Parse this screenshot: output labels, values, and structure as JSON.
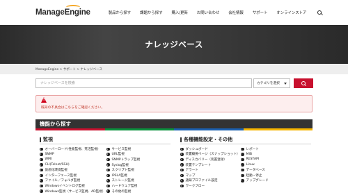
{
  "header": {
    "logo": "ManageEngine",
    "nav": [
      "製品から探す",
      "課題から探す",
      "購入/更新",
      "お問い合わせ",
      "会社情報",
      "サポート",
      "オンラインストア"
    ],
    "search_icon": "search-icon"
  },
  "hero": {
    "title": "ナレッジベース"
  },
  "breadcrumb": "ManageEngine > サポート > ナレッジベース",
  "search": {
    "placeholder": "ナレッジベースを検索",
    "category_label": "カテゴリを選択",
    "button_icon": "search-icon"
  },
  "alert": {
    "icon": "warning-icon",
    "text": "既知の不具合はこちらをご確認ください。"
  },
  "features": {
    "title": "機能から探す",
    "stripe_colors": [
      "#c8102e",
      "#0a8f3c",
      "#1b5fae",
      "#f5b400"
    ],
    "monitoring": {
      "title": "監視",
      "col1": [
        "オーバーロード(性能監視、死活監視)",
        "SNMP",
        "WMI",
        "CLI(Telnet/SSH)",
        "仮想化環境監視",
        "インターフェース監視",
        "ファイル／フォルダ監視",
        "Windowsイベントログ監視",
        "Windows監視（サービス監視、AD監視）"
      ],
      "col2": [
        "サービス監視",
        "URL監視",
        "SNMPトラップ監視",
        "Syslog監視",
        "スクリプト監視",
        "IPSLA監視",
        "ストレージ監視",
        "ハードウェア監視",
        "その他の監視"
      ]
    },
    "settings": {
      "title": "各種機能設定・その他",
      "col1": [
        "ダッシュボード",
        "装置概要ページ（スナップショット）",
        "ディスカバリー（装置登録）",
        "装置テンプレート",
        "アラート",
        "マップ",
        "通知プロファイル設定",
        "ワークフロー"
      ],
      "col2": [
        "レポート",
        "MIB",
        "RESTAPI",
        "Linux",
        "データベース",
        "起動・停止",
        "アップグレード"
      ]
    }
  }
}
